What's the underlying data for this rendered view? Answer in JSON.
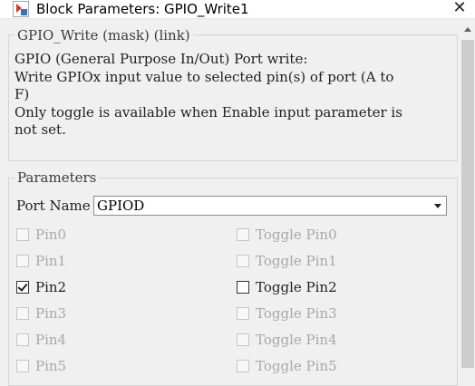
{
  "window": {
    "title": "Block Parameters: GPIO_Write1",
    "close_glyph": "✕"
  },
  "description": {
    "legend": "GPIO_Write (mask) (link)",
    "lines": [
      "GPIO (General Purpose In/Out) Port write:",
      "Write GPIOx input value to selected pin(s) of port (A to",
      "F)",
      "Only toggle is available when Enable input parameter is",
      "not set."
    ]
  },
  "parameters": {
    "legend": "Parameters",
    "port_name_label": "Port Name",
    "port_name_value": "GPIOD",
    "pins": [
      {
        "label": "Pin0",
        "checked": false,
        "enabled": false
      },
      {
        "label": "Pin1",
        "checked": false,
        "enabled": false
      },
      {
        "label": "Pin2",
        "checked": true,
        "enabled": true
      },
      {
        "label": "Pin3",
        "checked": false,
        "enabled": false
      },
      {
        "label": "Pin4",
        "checked": false,
        "enabled": false
      },
      {
        "label": "Pin5",
        "checked": false,
        "enabled": false
      }
    ],
    "toggles": [
      {
        "label": "Toggle Pin0",
        "checked": false,
        "enabled": false
      },
      {
        "label": "Toggle Pin1",
        "checked": false,
        "enabled": false
      },
      {
        "label": "Toggle Pin2",
        "checked": false,
        "enabled": true
      },
      {
        "label": "Toggle Pin3",
        "checked": false,
        "enabled": false
      },
      {
        "label": "Toggle Pin4",
        "checked": false,
        "enabled": false
      },
      {
        "label": "Toggle Pin5",
        "checked": false,
        "enabled": false
      }
    ]
  },
  "icons": {
    "app": "simulink-block-icon",
    "close": "close-icon",
    "dropdown": "chevron-down-icon"
  }
}
